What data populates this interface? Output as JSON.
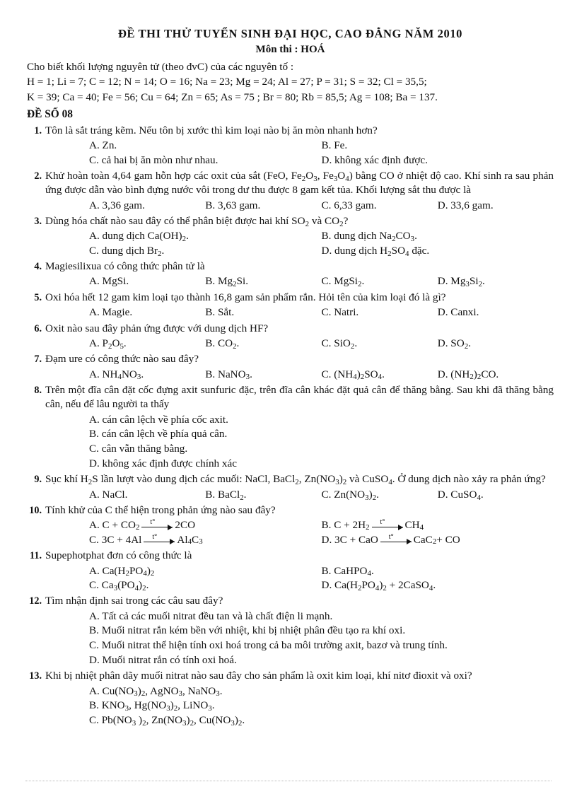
{
  "header": {
    "title": "ĐỀ THI THỬ TUYỂN SINH ĐẠI HỌC, CAO ĐẲNG NĂM 2010",
    "subject_line": "Môn thi : HOÁ",
    "lead": "Cho biết khối lượng nguyên tử (theo đvC) của các nguyên tố :",
    "masses_line_1": "H = 1; Li = 7; C = 12; N = 14; O = 16; Na = 23; Mg = 24; Al = 27; P = 31; S = 32; Cl = 35,5;",
    "masses_line_2": "K = 39; Ca = 40; Fe = 56; Cu = 64; Zn = 65; As = 75 ; Br = 80; Rb = 85,5; Ag = 108; Ba = 137.",
    "exam_code": "ĐỀ SỐ 08"
  },
  "questions": [
    {
      "num": "1.",
      "stem": "Tôn là sắt tráng kẽm. Nếu tôn bị xước thì kim loại nào bị ăn mòn nhanh hơn?",
      "layout": "2col",
      "options": [
        "A. Zn.",
        "B. Fe.",
        "C. cả hai bị ăn mòn như nhau.",
        "D. không xác định được."
      ]
    },
    {
      "num": "2.",
      "stem": "Khử hoàn toàn 4,64 gam hỗn hợp các oxit của sắt (FeO, Fe₂O₃, Fe₃O₄) bằng CO ở nhiệt độ cao. Khí sinh ra sau phản ứng  được dẫn vào bình đựng nước vôi trong dư thu được 8 gam kết tủa. Khối lượng sắt thu được là",
      "layout": "4col",
      "options": [
        "A. 3,36 gam.",
        "B. 3,63 gam.",
        "C. 6,33 gam.",
        "D. 33,6 gam."
      ]
    },
    {
      "num": "3.",
      "stem": "Dùng hóa chất nào sau đây có thể phân biệt được hai khí SO₂ và CO₂?",
      "layout": "2col",
      "options": [
        "A. dung dịch Ca(OH)₂.",
        "B. dung dịch Na₂CO₃.",
        "C. dung dịch Br₂.",
        "D. dung dịch H₂SO₄ đặc."
      ]
    },
    {
      "num": "4.",
      "stem": "Magiesilixua có công thức phân tử là",
      "layout": "4col",
      "options": [
        "A. MgSi.",
        "B. Mg₂Si.",
        "C. MgSi₂.",
        "D. Mg₃Si₂."
      ]
    },
    {
      "num": "5.",
      "stem": "Oxi hóa hết 12 gam kim loại tạo thành 16,8 gam sản phẩm rắn. Hỏi tên của kim loại đó là gì?",
      "layout": "4col",
      "options": [
        "A. Magie.",
        "B. Sắt.",
        "C. Natri.",
        "D. Canxi."
      ]
    },
    {
      "num": "6.",
      "stem": "Oxit nào sau đây phản ứng được với dung dịch HF?",
      "layout": "4col",
      "options": [
        "A. P₂O₅.",
        "B. CO₂.",
        "C. SiO₂.",
        "D. SO₂."
      ]
    },
    {
      "num": "7.",
      "stem": "Đạm ure có công thức nào sau đây?",
      "layout": "4col",
      "options": [
        "A. NH₄NO₃.",
        "B. NaNO₃.",
        "C. (NH₄)₂SO₄.",
        "D. (NH₂)₂CO."
      ]
    },
    {
      "num": "8.",
      "stem": "Trên một đĩa cân đặt cốc đựng axit sunfuric đặc, trên đĩa cân khác đặt quả cân để thăng bằng. Sau khi đã thăng bằng cân, nếu để lâu người ta thấy",
      "layout": "stack",
      "options": [
        "A. cán cân lệch về phía cốc axit.",
        "B. cán cân lệch về phía quả cân.",
        "C. cân vẫn thăng bằng.",
        "D. không xác định được chính xác"
      ]
    },
    {
      "num": "9.",
      "stem": "Sục khí H₂S lần lượt vào dung dịch các muối: NaCl, BaCl₂, Zn(NO₃)₂ và CuSO₄. Ở dung dịch nào xảy ra phản ứng?",
      "layout": "4col",
      "options": [
        "A. NaCl.",
        "B. BaCl₂.",
        "C. Zn(NO₃)₂.",
        "D. CuSO₄."
      ]
    },
    {
      "num": "10.",
      "stem": "Tính khử của C thể hiện trong phản ứng nào sau đây?",
      "layout": "reaction",
      "options": [
        "A.  C + CO₂ —t°→ 2CO",
        "B.  C + 2H₂ —t°→ CH₄",
        "C. 3C + 4Al —t°→ Al₄C₃",
        "D. 3C + CaO —t°→ CaC₂ + CO"
      ],
      "reactions": [
        {
          "label": "A.",
          "left": "C + CO",
          "left_sub": "2",
          "cond": "t°",
          "right_pre": "2CO",
          "right_sub": "",
          "right_post": ""
        },
        {
          "label": "B.",
          "left": "C + 2H",
          "left_sub": "2",
          "cond": "t°",
          "right_pre": "CH",
          "right_sub": "4",
          "right_post": ""
        },
        {
          "label": "C.",
          "left": "3C + 4Al",
          "left_sub": "",
          "cond": "t°",
          "right_pre": "Al",
          "right_sub": "4",
          "right_post": "C₃"
        },
        {
          "label": "D.",
          "left": "3C + CaO",
          "left_sub": "",
          "cond": "t°",
          "right_pre": "CaC",
          "right_sub": "2",
          "right_post": " + CO"
        }
      ]
    },
    {
      "num": "11.",
      "stem": "Supephotphat đơn có công thức là",
      "layout": "2col",
      "options": [
        "A. Ca(H₂PO₄)₂",
        "B. CaHPO₄.",
        "C. Ca₃(PO₄)₂.",
        "D. Ca(H₂PO₄)₂ + 2CaSO₄."
      ]
    },
    {
      "num": "12.",
      "stem": "Tìm nhận định sai trong các câu sau đây?",
      "layout": "stack",
      "options": [
        "A. Tất cả các muối nitrat đều tan và là chất điện li mạnh.",
        "B. Muối nitrat rắn kém bền với nhiệt, khi bị nhiệt phân đều tạo ra khí oxi.",
        "C. Muối nitrat thể hiện tính oxi hoá trong cả ba môi trường axit, bazơ và trung tính.",
        "D. Muối nitrat rắn có tính oxi hoá."
      ]
    },
    {
      "num": "13.",
      "stem": "Khi bị nhiệt phân dãy muối nitrat nào sau đây cho sản phẩm là oxit kim loại, khí nitơ đioxit và oxi?",
      "layout": "stack",
      "options": [
        "A. Cu(NO₃)₂, AgNO₃, NaNO₃.",
        "B. KNO₃, Hg(NO₃)₂, LiNO₃.",
        "C. Pb(NO₃  )₂, Zn(NO₃)₂, Cu(NO₃)₂."
      ]
    }
  ]
}
